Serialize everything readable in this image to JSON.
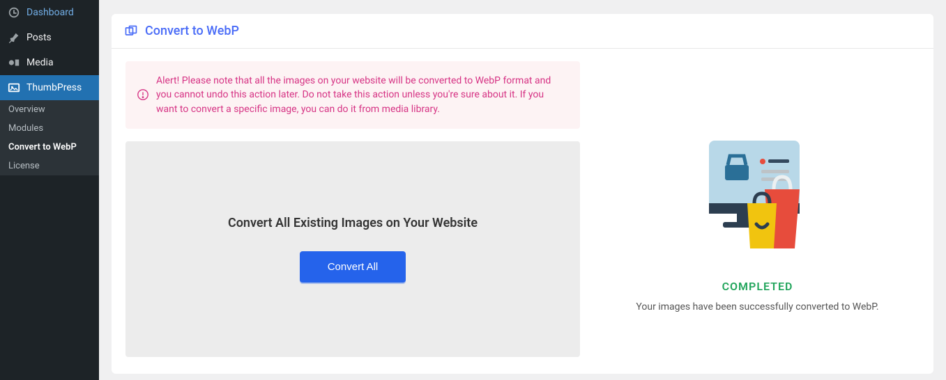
{
  "sidebar": {
    "items": [
      {
        "label": "Dashboard",
        "icon": "dashboard-icon"
      },
      {
        "label": "Posts",
        "icon": "pin-icon"
      },
      {
        "label": "Media",
        "icon": "media-icon"
      },
      {
        "label": "ThumbPress",
        "icon": "thumbpress-icon",
        "active": true
      }
    ],
    "subitems": [
      {
        "label": "Overview"
      },
      {
        "label": "Modules"
      },
      {
        "label": "Convert to WebP",
        "active": true
      },
      {
        "label": "License"
      }
    ]
  },
  "header": {
    "title": "Convert to WebP"
  },
  "alert": {
    "text": "Alert! Please note that all the images on your website will be converted to WebP format and you cannot undo this action later. Do not take this action unless you're sure about it. If you want to convert a specific image, you can do it from media library."
  },
  "convert": {
    "heading": "Convert All Existing Images on Your Website",
    "button_label": "Convert All"
  },
  "status": {
    "title": "COMPLETED",
    "text": "Your images have been successfully converted to WebP."
  },
  "colors": {
    "accent": "#4a6cf7",
    "alert": "#d63384",
    "success": "#22a55c",
    "button": "#2563eb"
  }
}
